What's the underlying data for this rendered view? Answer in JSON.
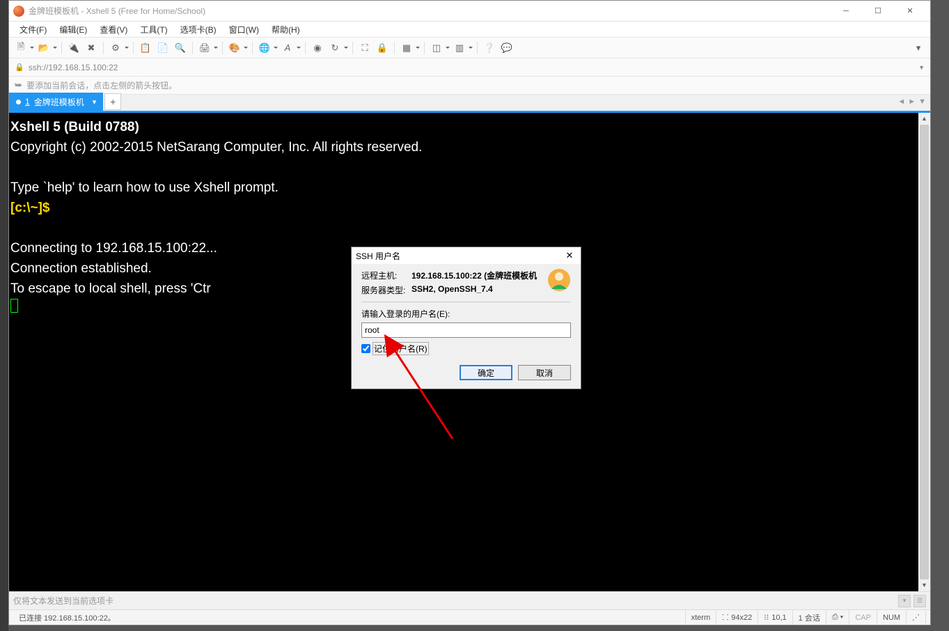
{
  "titlebar": {
    "text": "金牌班模板机 - Xshell 5 (Free for Home/School)"
  },
  "menu": [
    "文件(F)",
    "编辑(E)",
    "查看(V)",
    "工具(T)",
    "选项卡(B)",
    "窗口(W)",
    "帮助(H)"
  ],
  "address": {
    "url": "ssh://192.168.15.100:22"
  },
  "hint": {
    "text": "要添加当前会话，点击左侧的箭头按钮。"
  },
  "tab": {
    "num": "1",
    "label": "金牌班模板机"
  },
  "terminal": {
    "l1": "Xshell 5 (Build 0788)",
    "l2": "Copyright (c) 2002-2015 NetSarang Computer, Inc. All rights reserved.",
    "l3": "Type `help' to learn how to use Xshell prompt.",
    "prompt": "[c:\\~]$",
    "l4": "Connecting to 192.168.15.100:22...",
    "l5": "Connection established.",
    "l6": "To escape to local shell, press 'Ctr"
  },
  "dialog": {
    "title": "SSH 用户名",
    "remote_label": "远程主机:",
    "remote_value": "192.168.15.100:22 (金牌班模板机",
    "type_label": "服务器类型:",
    "type_value": "SSH2, OpenSSH_7.4",
    "prompt": "请输入登录的用户名(E):",
    "username": "root",
    "remember": "记住用户名(R)",
    "ok": "确定",
    "cancel": "取消"
  },
  "sendbar": {
    "placeholder": "仅将文本发送到当前选项卡"
  },
  "status": {
    "conn": "已连接 192.168.15.100:22。",
    "term": "xterm",
    "size": "94x22",
    "cursor": "10,1",
    "sessions": "1 会话",
    "cap": "CAP",
    "num": "NUM"
  }
}
